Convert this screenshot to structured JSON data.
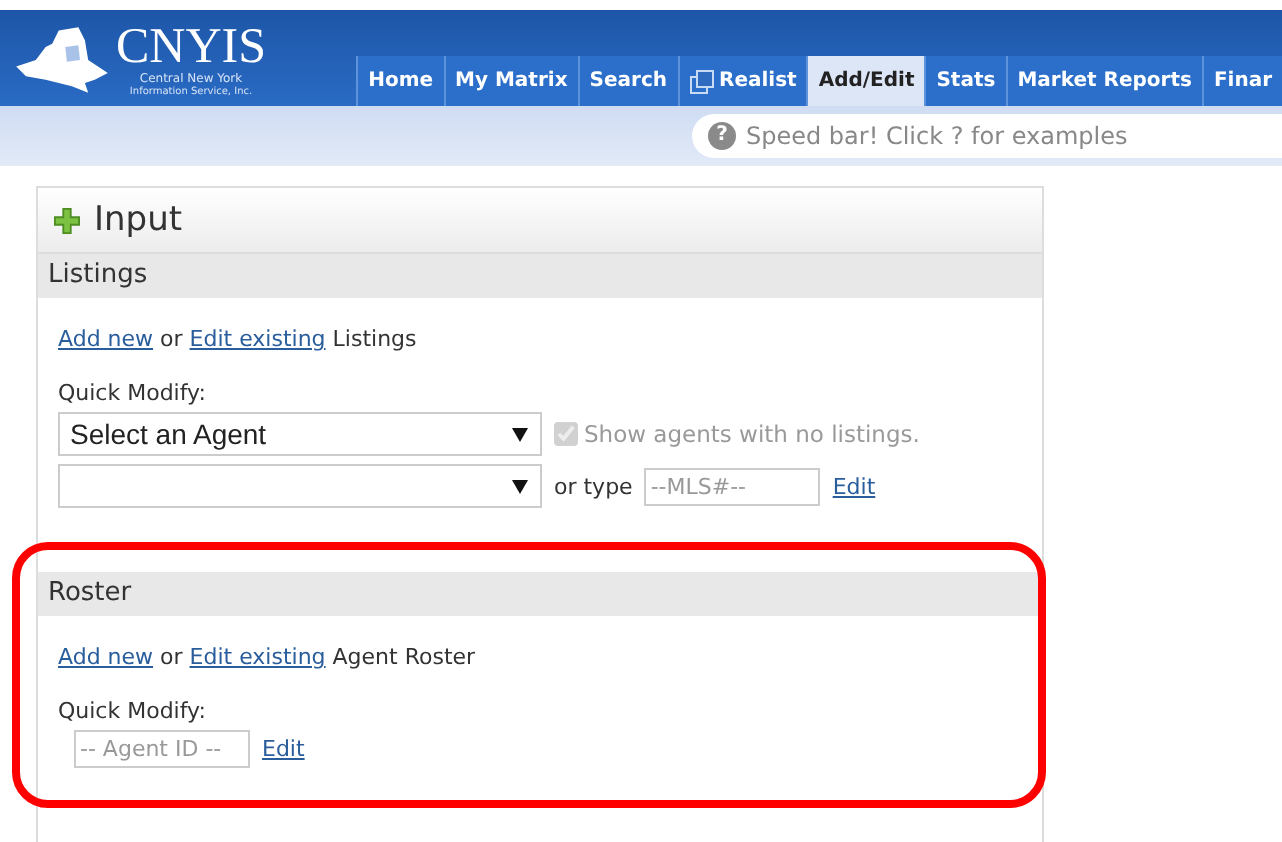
{
  "logo": {
    "name": "CNYIS",
    "tagline": "Central New York",
    "subtitle": "Information Service, Inc."
  },
  "tabs": [
    {
      "label": "Home",
      "selected": false
    },
    {
      "label": "My Matrix",
      "selected": false
    },
    {
      "label": "Search",
      "selected": false
    },
    {
      "label": "Realist",
      "selected": false,
      "kind": "popup"
    },
    {
      "label": "Add/Edit",
      "selected": true
    },
    {
      "label": "Stats",
      "selected": false
    },
    {
      "label": "Market Reports",
      "selected": false
    },
    {
      "label": "Finar",
      "selected": false
    }
  ],
  "speed_bar": {
    "help": "?",
    "placeholder": "Speed bar! Click ? for examples"
  },
  "panel": {
    "title": "Input",
    "sections": [
      {
        "title": "Listings",
        "highlighted": false,
        "intro": [
          {
            "kind": "link",
            "text": "Add new"
          },
          {
            "kind": "text",
            "text": " or "
          },
          {
            "kind": "link",
            "text": "Edit existing"
          },
          {
            "kind": "text",
            "text": " Listings"
          }
        ],
        "quick_modify_label": "Quick Modify:",
        "rows": [
          [
            {
              "kind": "select",
              "value": "Select an Agent"
            },
            {
              "kind": "checkbox",
              "label": "Show agents with no listings.",
              "checked": true,
              "disabled": true
            }
          ],
          [
            {
              "kind": "select"
            },
            {
              "kind": "text",
              "text": "or type"
            },
            {
              "kind": "input",
              "placeholder": "--MLS#--"
            },
            {
              "kind": "link",
              "text": "Edit"
            }
          ]
        ]
      },
      {
        "title": "Roster",
        "highlighted": true,
        "intro": [
          {
            "kind": "link",
            "text": "Add new"
          },
          {
            "kind": "text",
            "text": " or "
          },
          {
            "kind": "link",
            "text": "Edit existing"
          },
          {
            "kind": "text",
            "text": " Agent Roster"
          }
        ],
        "quick_modify_label": "Quick Modify:",
        "rows": [
          [
            {
              "kind": "input",
              "placeholder": "-- Agent ID --"
            },
            {
              "kind": "link",
              "text": "Edit"
            }
          ]
        ]
      }
    ]
  }
}
